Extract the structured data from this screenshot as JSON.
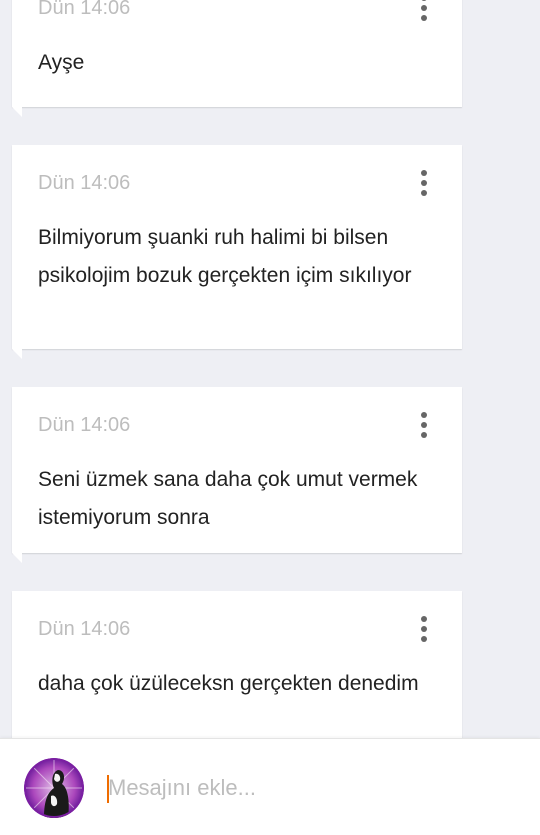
{
  "messages": [
    {
      "timestamp": "Dün 14:06",
      "text": "Ayşe"
    },
    {
      "timestamp": "Dün 14:06",
      "text": "Bilmiyorum şuanki ruh halimi bi bilsen psikolojim bozuk gerçekten içim sıkılıyor"
    },
    {
      "timestamp": "Dün 14:06",
      "text": "Seni üzmek sana daha çok umut vermek istemiyorum sonra"
    },
    {
      "timestamp": "Dün 14:06",
      "text": "daha çok üzüleceksn gerçekten denedim"
    }
  ],
  "composer": {
    "placeholder": "Mesajını ekle..."
  },
  "icons": {
    "card_menu": "more-vertical-icon",
    "avatar": "user-avatar"
  },
  "colors": {
    "background": "#eeeff4",
    "card": "#ffffff",
    "timestamp": "#bdbdbd",
    "caret": "#ef6c00",
    "avatar_ring": "#9c27b0"
  }
}
